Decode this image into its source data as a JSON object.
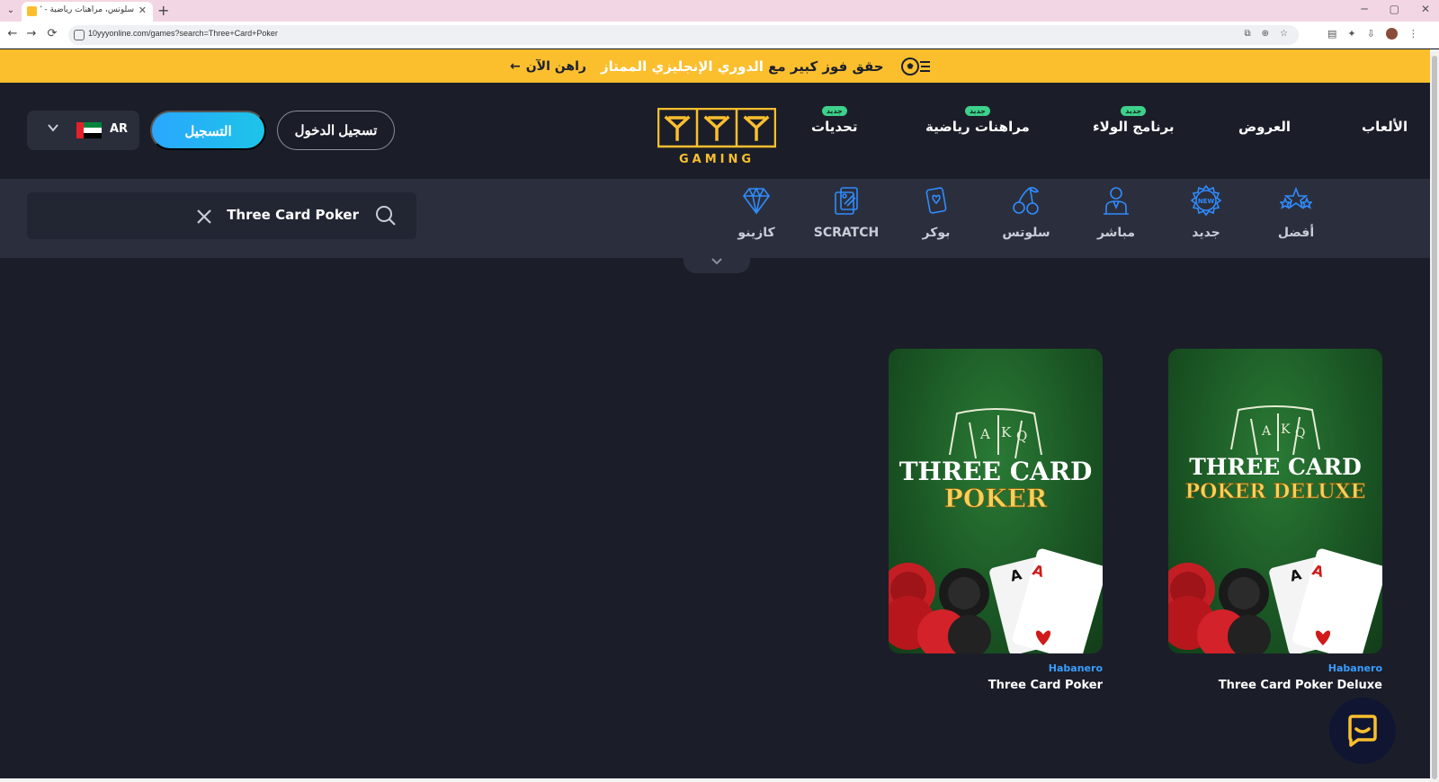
{
  "browser": {
    "tab_title": "سلوتس، مراهنات رياضية - YYY™",
    "tab_close": "✕",
    "new_tab": "+",
    "url": "10yyyonline.com/games?search=Three+Card+Poker",
    "nav": {
      "back": "←",
      "forward": "→",
      "reload": "⟳"
    },
    "window": {
      "minimize": "─",
      "maximize": "▢",
      "close": "✕"
    }
  },
  "promo": {
    "text_before": "حقق فوز كبير مع ",
    "text_highlight": "الدوري الإنجليزي الممتاز",
    "cta": "راهن الآن",
    "cta_arrow": "←"
  },
  "header": {
    "nav": [
      {
        "label": "الألعاب",
        "badge": ""
      },
      {
        "label": "العروض",
        "badge": ""
      },
      {
        "label": "برنامج الولاء",
        "badge": "جديد"
      },
      {
        "label": "مراهنات رياضية",
        "badge": "جديد"
      },
      {
        "label": "تحديات",
        "badge": "جديد"
      }
    ],
    "logo_text": "GAMING",
    "login": "تسجيل الدخول",
    "register": "التسجيل",
    "lang_code": "AR"
  },
  "search": {
    "value": "Three Card Poker"
  },
  "categories": [
    {
      "label": "أفضل",
      "icon": "stars-icon"
    },
    {
      "label": "جديد",
      "icon": "new-badge-icon"
    },
    {
      "label": "مباشر",
      "icon": "live-dealer-icon"
    },
    {
      "label": "سلوتس",
      "icon": "cherry-icon"
    },
    {
      "label": "بوكر",
      "icon": "poker-card-icon"
    },
    {
      "label": "SCRATCH",
      "icon": "scratch-icon"
    },
    {
      "label": "كازينو",
      "icon": "diamond-icon"
    }
  ],
  "games": [
    {
      "name": "Three Card Poker Deluxe",
      "provider": "Habanero",
      "art_line1": "THREE CARD",
      "art_line2": "POKER DELUXE"
    },
    {
      "name": "Three Card Poker",
      "provider": "Habanero",
      "art_line1": "THREE CARD",
      "art_line2": "POKER"
    }
  ],
  "colors": {
    "banner": "#fbbf2e",
    "accent_blue": "#2aa7ff",
    "badge_green": "#3ed18c",
    "provider_blue": "#3a9cff",
    "background": "#1b1e29"
  }
}
